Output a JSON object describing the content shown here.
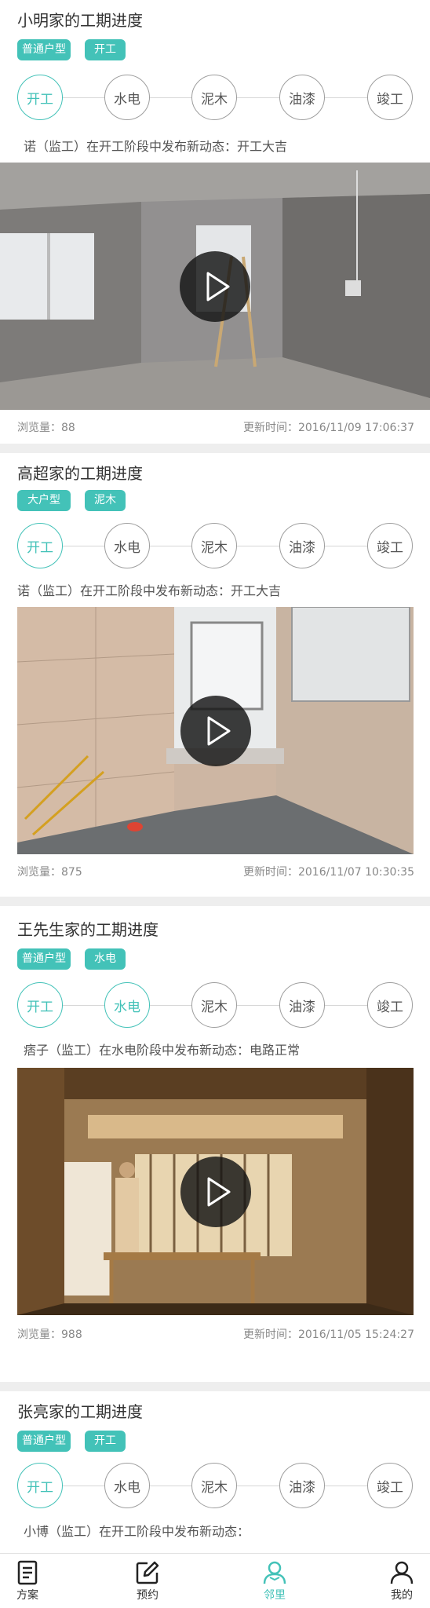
{
  "steps": [
    "开工",
    "水电",
    "泥木",
    "油漆",
    "竣工"
  ],
  "colors": {
    "accent": "#43c2b8",
    "divider": "#eeeeee"
  },
  "cards": [
    {
      "title": "小明家的工期进度",
      "tags": [
        "普通户型",
        "开工"
      ],
      "done_steps": 1,
      "update": "诺（监工）在开工阶段中发布新动态：开工大吉",
      "views": "浏览量：88",
      "updated": "更新时间：2016/11/09  17:06:37"
    },
    {
      "title": "高超家的工期进度",
      "tags": [
        "大户型",
        "泥木"
      ],
      "done_steps": 1,
      "update": "诺（监工）在开工阶段中发布新动态：开工大吉",
      "views": "浏览量：875",
      "updated": "更新时间：2016/11/07  10:30:35"
    },
    {
      "title": "王先生家的工期进度",
      "tags": [
        "普通户型",
        "水电"
      ],
      "done_steps": 2,
      "update": "痞子（监工）在水电阶段中发布新动态：电路正常",
      "views": "浏览量：988",
      "updated": "更新时间：2016/11/05  15:24:27"
    },
    {
      "title": "张亮家的工期进度",
      "tags": [
        "普通户型",
        "开工"
      ],
      "done_steps": 1,
      "update": "小博（监工）在开工阶段中发布新动态："
    }
  ],
  "tabbar": [
    {
      "label": "方案",
      "icon": "document-icon"
    },
    {
      "label": "预约",
      "icon": "edit-icon"
    },
    {
      "label": "邻里",
      "icon": "person-icon",
      "active": true
    },
    {
      "label": "我的",
      "icon": "user-icon"
    }
  ]
}
